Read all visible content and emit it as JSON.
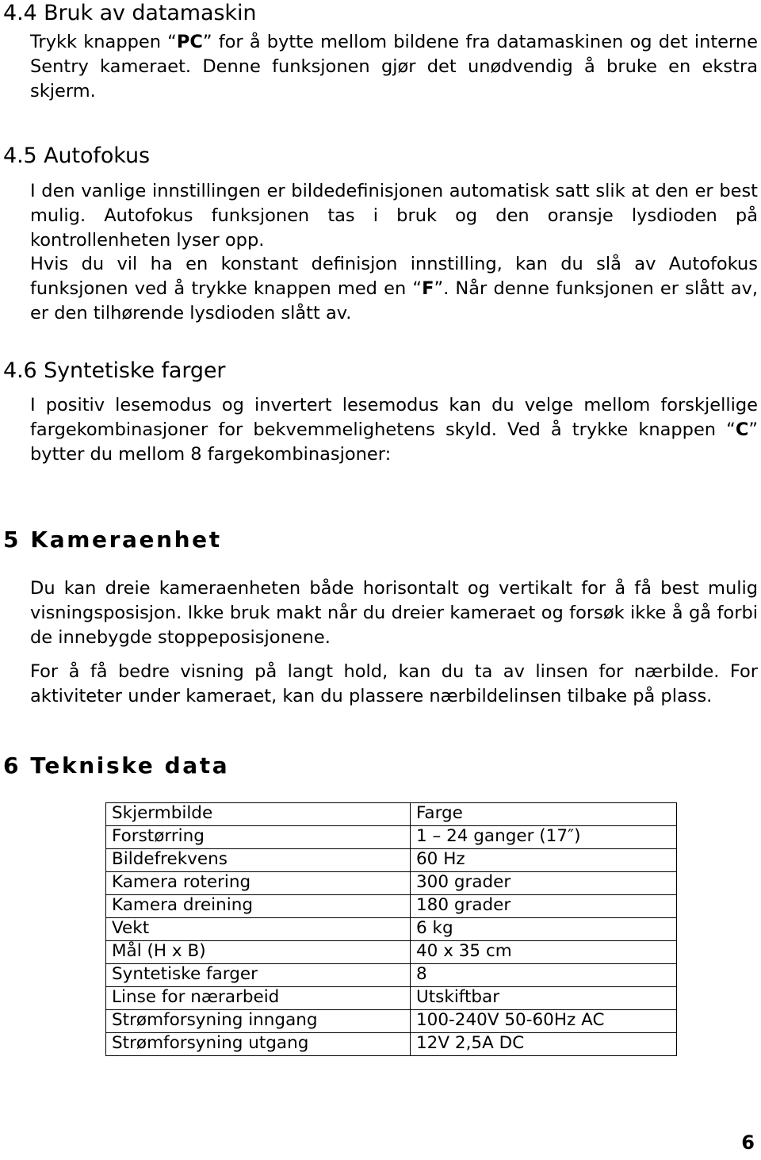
{
  "document": {
    "page_number": "6"
  },
  "sections": {
    "s44": {
      "heading": "4.4 Bruk av datamaskin",
      "body_prefix": "Trykk knappen “",
      "body_bold": "PC",
      "body_suffix": "” for å bytte mellom bildene fra datamaskinen og det interne Sentry kameraet. Denne funksjonen gjør det unødvendig å bruke en ekstra skjerm."
    },
    "s45": {
      "heading": "4.5 Autofokus",
      "body1": "I den vanlige innstillingen er bildedefinisjonen automatisk satt slik at den er best mulig. Autofokus funksjonen tas i bruk og den oransje lysdioden på kontrollenheten lyser opp.",
      "body2_prefix": "Hvis du vil ha en konstant definisjon innstilling, kan du slå av Autofokus funksjonen ved å trykke knappen med en “",
      "body2_bold": "F",
      "body2_suffix": "”. Når denne funksjonen er slått av, er den tilhørende lysdioden slått av."
    },
    "s46": {
      "heading": "4.6 Syntetiske farger",
      "body_prefix": "I positiv lesemodus og invertert lesemodus kan du velge mellom forskjellige fargekombinasjoner for bekvemmelighetens skyld. Ved å trykke knappen “",
      "body_bold": "C",
      "body_suffix": "” bytter du mellom 8 fargekombinasjoner:"
    },
    "s5": {
      "heading": "5 Kameraenhet",
      "body1": "Du kan dreie kameraenheten både horisontalt og vertikalt for å få best mulig visningsposisjon. Ikke bruk makt når du dreier kameraet og forsøk ikke å gå forbi de innebygde stoppeposisjonene.",
      "body2": "For å få bedre visning på langt hold, kan du ta av linsen for nærbilde. For aktiviteter under kameraet, kan du plassere nærbildelinsen tilbake på plass."
    },
    "s6": {
      "heading": "6 Tekniske data",
      "table": {
        "rows": [
          {
            "label": "Skjermbilde",
            "value": "Farge"
          },
          {
            "label": "Forstørring",
            "value": "1 – 24 ganger (17″)"
          },
          {
            "label": "Bildefrekvens",
            "value": "60 Hz"
          },
          {
            "label": "Kamera rotering",
            "value": "300 grader"
          },
          {
            "label": "Kamera dreining",
            "value": "180 grader"
          },
          {
            "label": "Vekt",
            "value": "6 kg"
          },
          {
            "label": "Mål (H x B)",
            "value": "40 x 35 cm"
          },
          {
            "label": "Syntetiske farger",
            "value": "8"
          },
          {
            "label": "Linse for nærarbeid",
            "value": "Utskiftbar"
          },
          {
            "label": "Strømforsyning inngang",
            "value": "100-240V 50-60Hz AC"
          },
          {
            "label": "Strømforsyning utgang",
            "value": "12V 2,5A DC"
          }
        ]
      }
    }
  }
}
